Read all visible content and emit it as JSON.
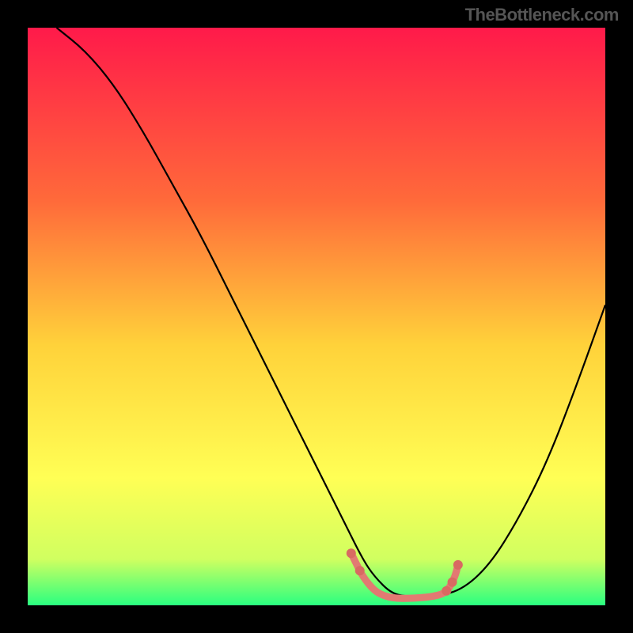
{
  "watermark": "TheBottleneck.com",
  "chart_data": {
    "type": "line",
    "title": "",
    "xlabel": "",
    "ylabel": "",
    "xlim": [
      0,
      100
    ],
    "ylim": [
      0,
      100
    ],
    "gradient_colors": {
      "top": "#ff1a4a",
      "mid1": "#ff6a3a",
      "mid2": "#ffd23a",
      "mid3": "#ffff55",
      "mid4": "#d0ff60",
      "bottom": "#2aff80"
    },
    "series": [
      {
        "name": "bottleneck-curve",
        "type": "line",
        "stroke": "#000000",
        "x": [
          5,
          10,
          15,
          20,
          25,
          30,
          35,
          40,
          45,
          50,
          55,
          58,
          60,
          63,
          66,
          70,
          75,
          80,
          85,
          90,
          95,
          100
        ],
        "y": [
          100,
          96,
          90,
          82,
          73,
          64,
          54,
          44,
          34,
          24,
          14,
          8,
          5,
          2,
          1.5,
          1.5,
          2.5,
          7,
          15,
          25,
          38,
          52
        ]
      },
      {
        "name": "highlight-region",
        "type": "line",
        "stroke": "#e27a72",
        "x": [
          56,
          57,
          58,
          60,
          62,
          64,
          66,
          68,
          70,
          72,
          73,
          74,
          74.5
        ],
        "y": [
          9,
          7,
          5,
          2.5,
          1.5,
          1.2,
          1.2,
          1.3,
          1.5,
          2,
          3,
          5,
          7
        ]
      }
    ],
    "highlight_dots": {
      "color": "#d86a62",
      "points": [
        {
          "x": 56,
          "y": 9
        },
        {
          "x": 57.5,
          "y": 6
        },
        {
          "x": 72.5,
          "y": 2.5
        },
        {
          "x": 73.5,
          "y": 4
        },
        {
          "x": 74.5,
          "y": 7
        }
      ]
    }
  }
}
